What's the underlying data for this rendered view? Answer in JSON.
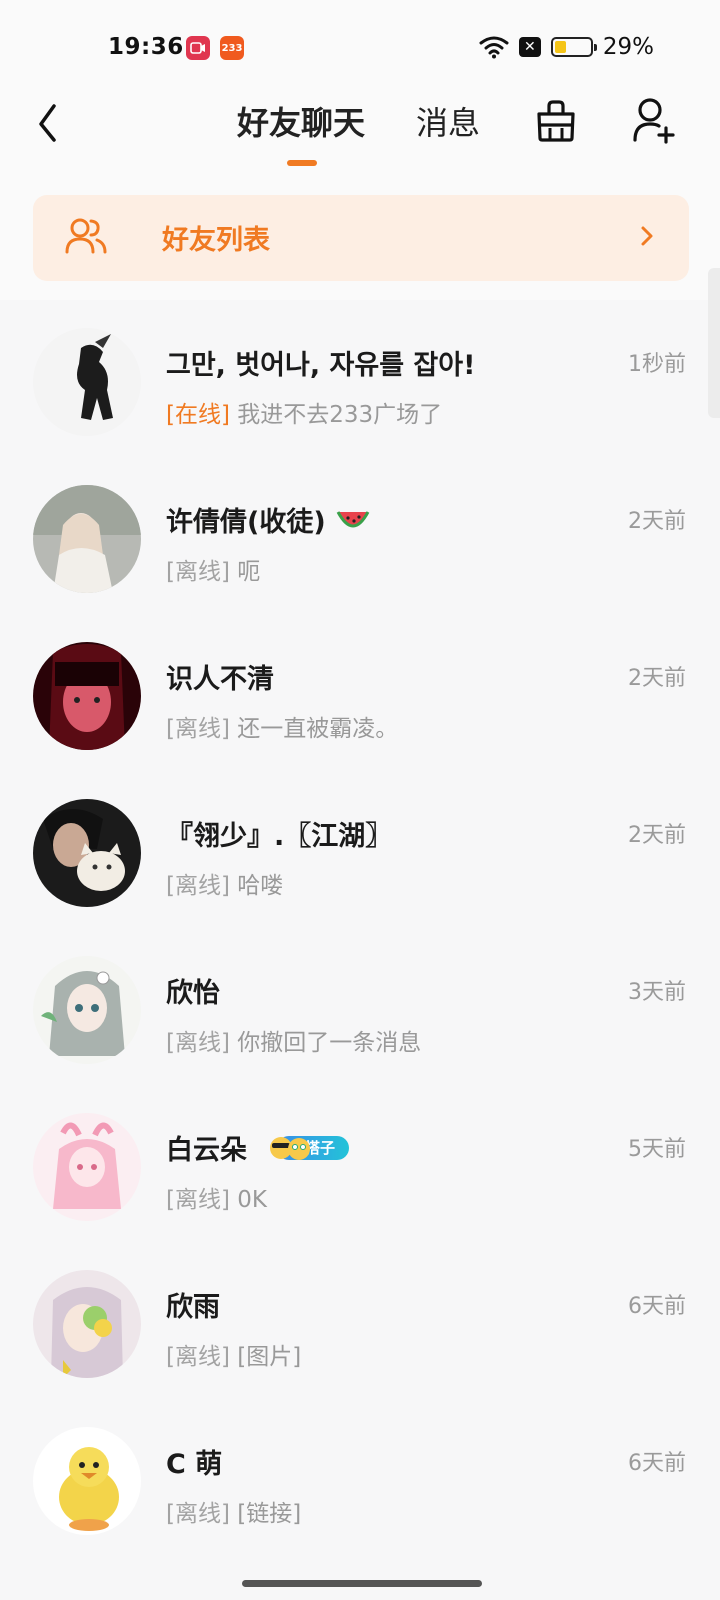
{
  "status_bar": {
    "time": "19:36",
    "app_icon_1": "record-icon",
    "app_icon_2_text": "233",
    "battery_percent": "29%",
    "battery_level": 0.29
  },
  "header": {
    "tab_chat": "好友聊天",
    "tab_messages": "消息"
  },
  "friend_banner": {
    "label": "好友列表"
  },
  "colors": {
    "accent": "#f07a22",
    "banner_bg": "#fdeee3"
  },
  "chats": [
    {
      "name": "그만, 벗어나, 자유를 잡아!",
      "time": "1秒前",
      "status": "[在线]",
      "online": true,
      "message": "我进不去233广场了"
    },
    {
      "name": "许倩倩(收徒)",
      "time": "2天前",
      "status": "[离线]",
      "online": false,
      "message": "呃"
    },
    {
      "name": "识人不清",
      "time": "2天前",
      "status": "[离线]",
      "online": false,
      "message": "还一直被霸凌。"
    },
    {
      "name": "『翎少』.〖江湖〗",
      "time": "2天前",
      "status": "[离线]",
      "online": false,
      "message": "哈喽"
    },
    {
      "name": "欣怡",
      "time": "3天前",
      "status": "[离线]",
      "online": false,
      "message": "你撤回了一条消息"
    },
    {
      "name": "白云朵",
      "time": "5天前",
      "status": "[离线]",
      "online": false,
      "message": "0K",
      "badge": "搭子"
    },
    {
      "name": "欣雨",
      "time": "6天前",
      "status": "[离线]",
      "online": false,
      "message": "[图片]"
    },
    {
      "name": "C 萌",
      "time": "6天前",
      "status": "[离线]",
      "online": false,
      "message": "[链接]"
    }
  ]
}
